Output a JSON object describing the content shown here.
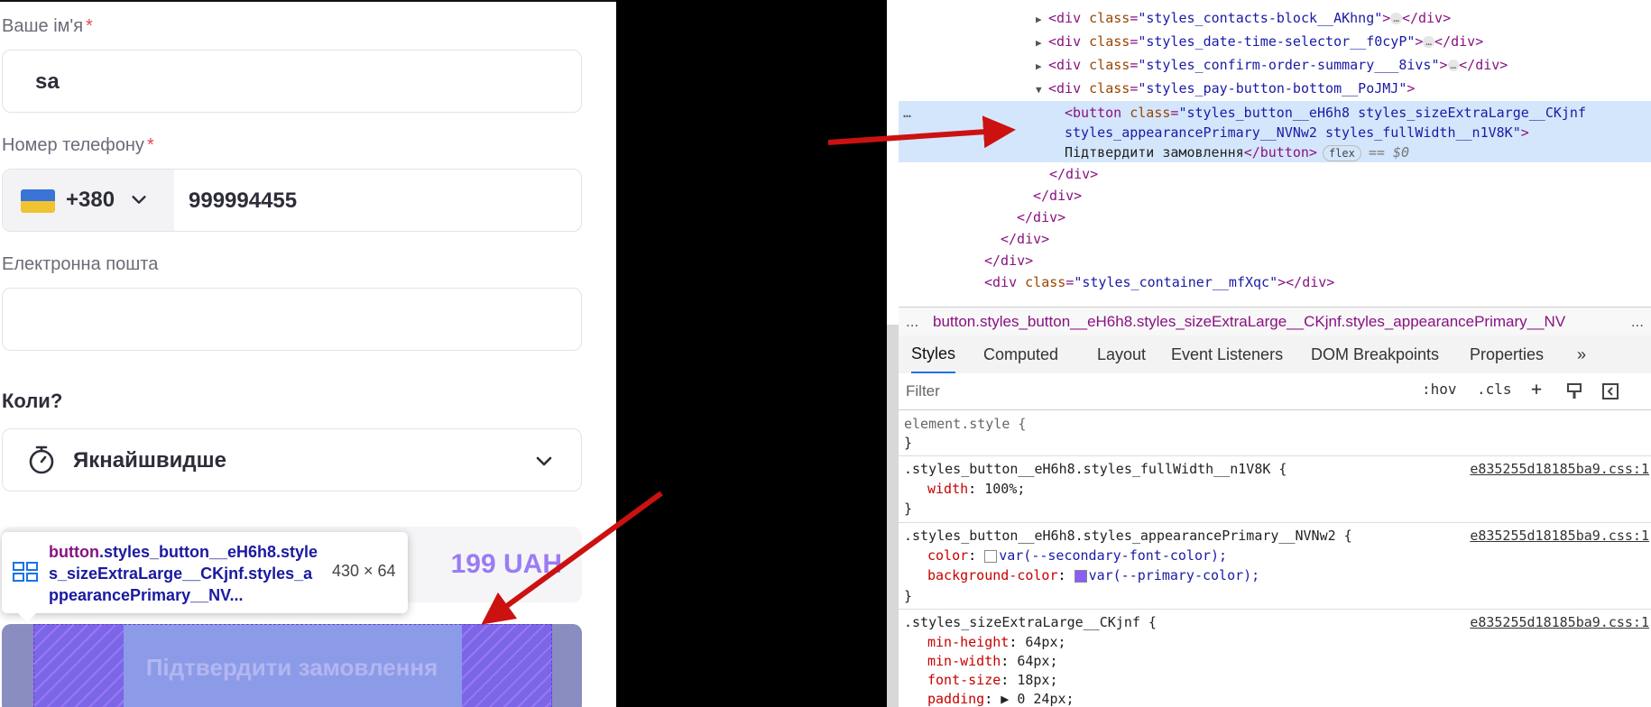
{
  "form": {
    "name_label": "Ваше ім'я",
    "required_mark": "*",
    "name_value": "sa",
    "phone_label": "Номер телефону",
    "phone_code": "+380",
    "phone_value": "999994455",
    "email_label": "Електронна пошта",
    "email_value": "",
    "when_label": "Коли?",
    "when_value": "Якнайшвидше",
    "price": "199 UAH",
    "confirm_button": "Підтвердити замовлення"
  },
  "inspector_tooltip": {
    "tag": "button",
    "classes": ".styles_button__eH6h8.styles_sizeExtraLarge__CKjnf.styles_appearancePrimary__NV...",
    "size": "430 × 64"
  },
  "devtools": {
    "dom_lines": [
      {
        "tri": "▶",
        "tag": "div",
        "cls": "styles_contacts-block__AKhng",
        "collapsed": true
      },
      {
        "tri": "▶",
        "tag": "div",
        "cls": "styles_date-time-selector__f0cyP",
        "collapsed": true
      },
      {
        "tri": "▶",
        "tag": "div",
        "cls": "styles_confirm-order-summary___8ivs",
        "collapsed": true
      },
      {
        "tri": "▼",
        "tag": "div",
        "cls": "styles_pay-button-bottom__PoJMJ",
        "collapsed": false
      }
    ],
    "selected_node": {
      "line1": "styles_button__eH6h8 styles_sizeExtraLarge__CKjnf",
      "line2": "styles_appearancePrimary__NVNw2 styles_fullWidth__n1V8K",
      "text": "Підтвердити замовлення",
      "badge": "flex",
      "ref": "== $0"
    },
    "closing_div": "</div>",
    "container_cls": "styles_container__mfXqc",
    "breadcrumb": {
      "left": "...",
      "text": "button.styles_button__eH6h8.styles_sizeExtraLarge__CKjnf.styles_appearancePrimary__NV",
      "right": "..."
    },
    "tabs": [
      "Styles",
      "Computed",
      "Layout",
      "Event Listeners",
      "DOM Breakpoints",
      "Properties",
      "»"
    ],
    "filter_placeholder": "Filter",
    "filter_buttons": [
      ":hov",
      ".cls",
      "+"
    ],
    "rules": [
      {
        "selector": "element.style {",
        "source": "",
        "decls": []
      },
      {
        "selector": ".styles_button__eH6h8.styles_fullWidth__n1V8K {",
        "source": "e835255d18185ba9.css:1",
        "decls": [
          {
            "prop": "width",
            "val": "100%;"
          }
        ]
      },
      {
        "selector": ".styles_button__eH6h8.styles_appearancePrimary__NVNw2 {",
        "source": "e835255d18185ba9.css:1",
        "decls": [
          {
            "prop": "color",
            "val": "var(--secondary-font-color);",
            "swatch": "#ffffff"
          },
          {
            "prop": "background-color",
            "val": "var(--primary-color);",
            "swatch": "#8b5cf6"
          }
        ]
      },
      {
        "selector": ".styles_sizeExtraLarge__CKjnf {",
        "source": "e835255d18185ba9.css:1",
        "decls": [
          {
            "prop": "min-height",
            "val": "64px;"
          },
          {
            "prop": "min-width",
            "val": "64px;"
          },
          {
            "prop": "font-size",
            "val": "18px;"
          },
          {
            "prop": "padding",
            "val": "▶ 0 24px;"
          }
        ]
      }
    ],
    "close_brace": "}"
  },
  "colors": {
    "accent": "#9a7cf4",
    "arrow": "#cc1111",
    "selection": "#d4e6fb"
  }
}
